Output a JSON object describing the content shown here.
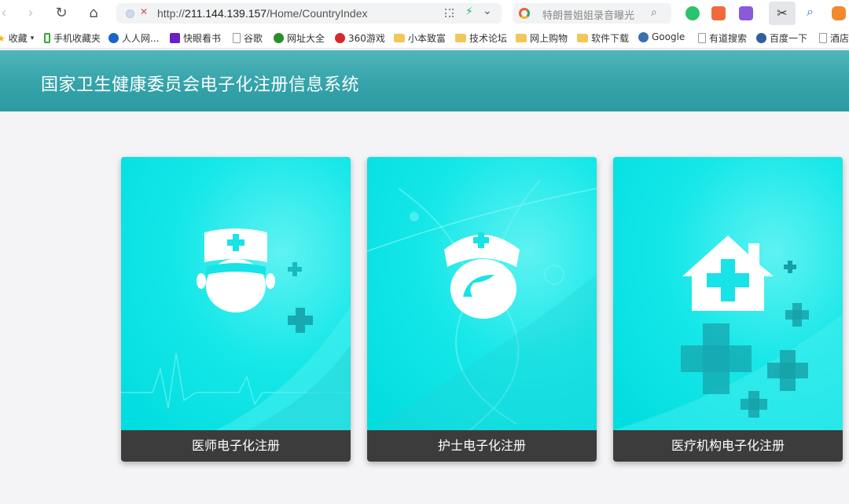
{
  "browser": {
    "address": {
      "scheme": "http://",
      "host": "211.144.139.157",
      "path": "/Home/CountryIndex"
    },
    "search_placeholder": "特朗普姐姐录音曝光",
    "bookmarks": [
      {
        "label": "收藏",
        "icon": "star-icon"
      },
      {
        "label": "手机收藏夹",
        "icon": "phone-icon"
      },
      {
        "label": "人人网...",
        "icon": "renren-icon"
      },
      {
        "label": "快眼看书",
        "icon": "book-icon"
      },
      {
        "label": "谷歌",
        "icon": "page-icon"
      },
      {
        "label": "网址大全",
        "icon": "globe-icon"
      },
      {
        "label": "360游戏",
        "icon": "game-icon"
      },
      {
        "label": "小本致富",
        "icon": "folder-icon"
      },
      {
        "label": "技术论坛",
        "icon": "folder-icon"
      },
      {
        "label": "网上购物",
        "icon": "folder-icon"
      },
      {
        "label": "软件下载",
        "icon": "folder-icon"
      },
      {
        "label": "Google",
        "icon": "google-icon"
      },
      {
        "label": "有道搜索",
        "icon": "page-icon"
      },
      {
        "label": "百度一下",
        "icon": "baidu-icon"
      },
      {
        "label": "酒店",
        "icon": "page-icon"
      }
    ]
  },
  "site": {
    "title": "国家卫生健康委员会电子化注册信息系统",
    "header_color": "#35a3a9"
  },
  "cards": [
    {
      "label": "医师电子化注册",
      "icon": "doctor-icon"
    },
    {
      "label": "护士电子化注册",
      "icon": "nurse-icon"
    },
    {
      "label": "医疗机构电子化注册",
      "icon": "hospital-icon"
    }
  ],
  "colors": {
    "card_bg": "#10e6e6",
    "card_label_bg": "#3d3c3d"
  }
}
